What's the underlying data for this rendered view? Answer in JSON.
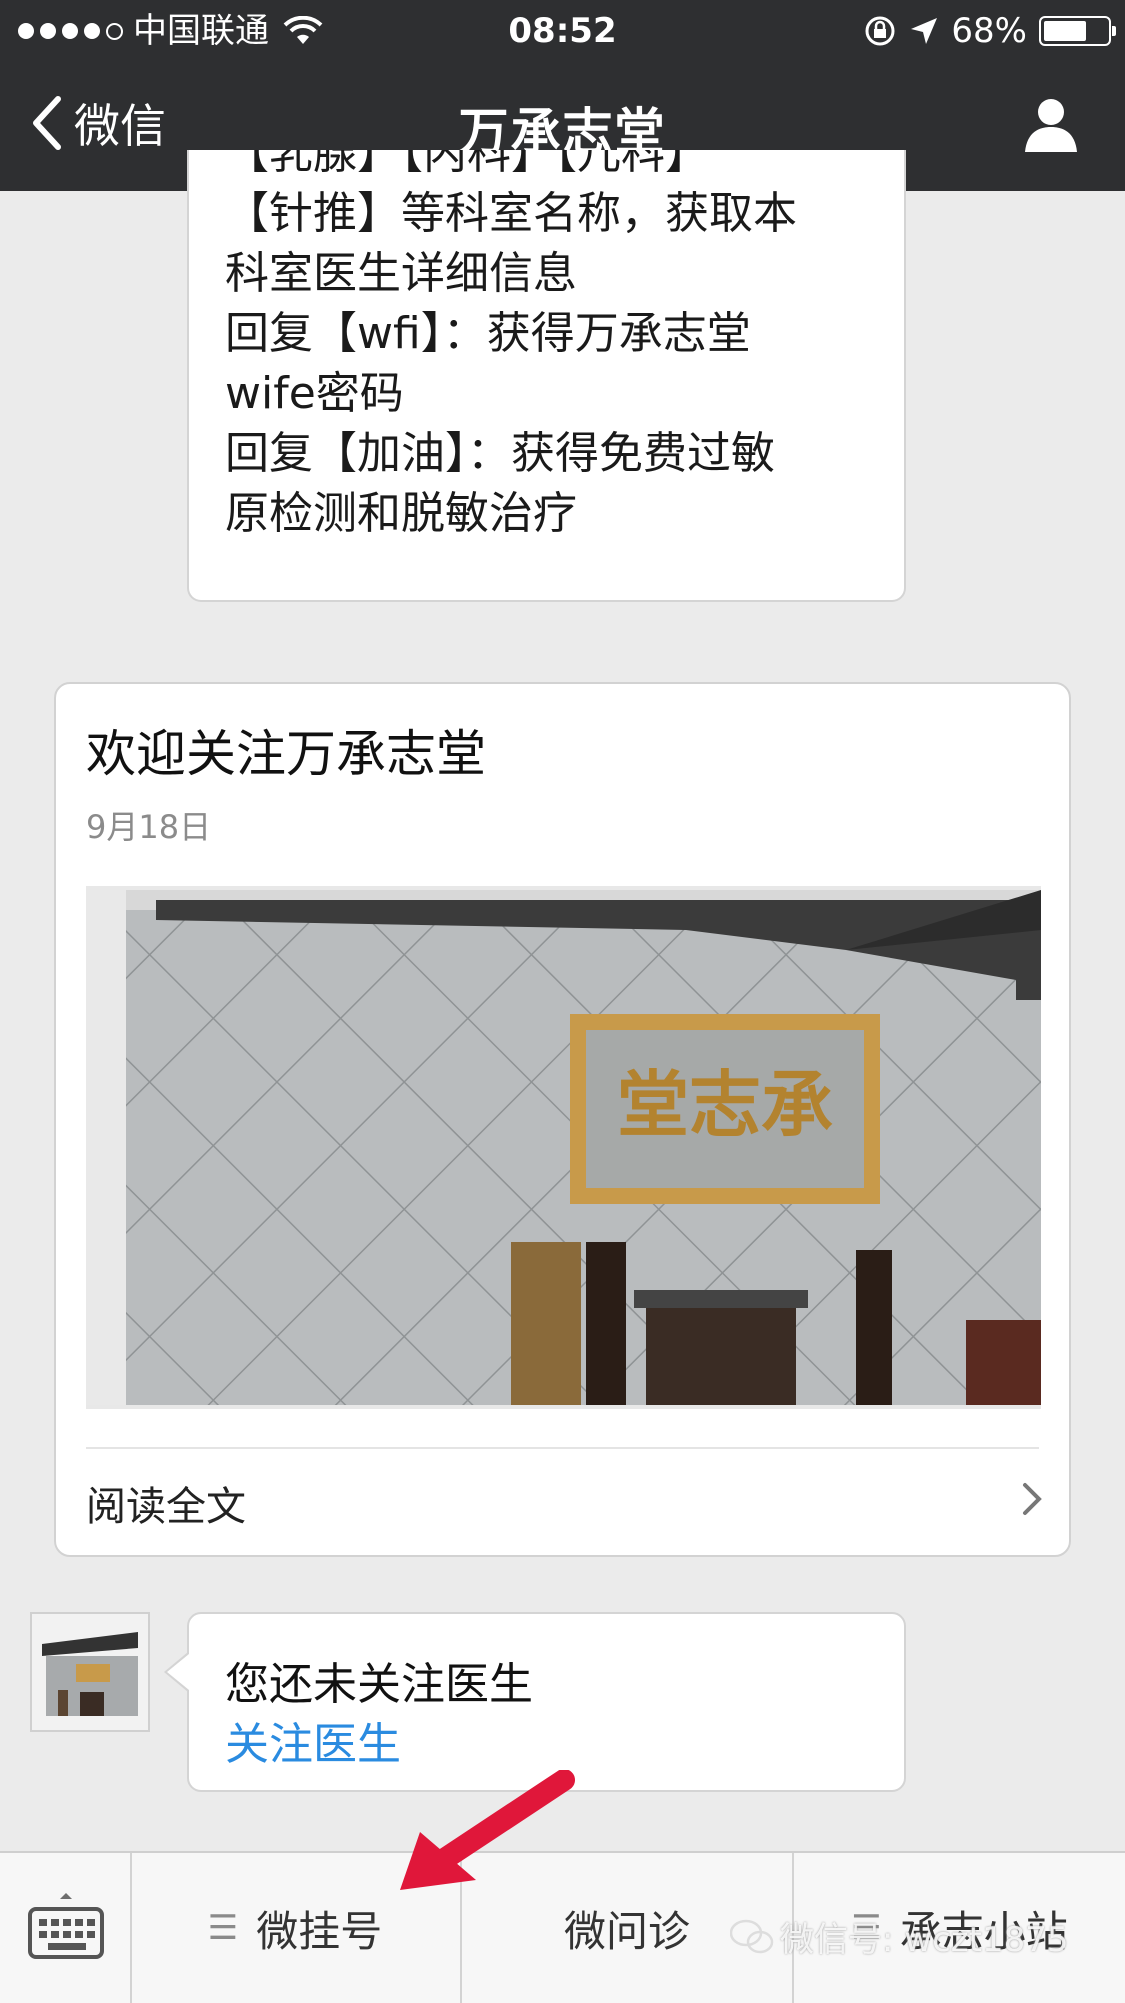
{
  "status_bar": {
    "carrier": "中国联通",
    "time": "08:52",
    "battery": "68%",
    "battery_level": 0.68
  },
  "nav": {
    "back_label": "微信",
    "title": "万承志堂"
  },
  "chat": {
    "first_message_text": "【针推】等科室名称，获取本\n科室医生详细信息\n回复【wfi】：获得万承志堂\nwife密码\n回复【加油】：获得免费过敏\n原检测和脱敏治疗",
    "first_message_top_partial": "【乳腺】【内科】【儿科】",
    "article": {
      "title": "欢迎关注万承志堂",
      "date": "9月18日",
      "plaque_text": "堂志承",
      "read_more": "阅读全文"
    },
    "last_message": {
      "text": "您还未关注医生",
      "link": "关注医生"
    }
  },
  "bottom_menu": {
    "items": [
      {
        "label": "微挂号"
      },
      {
        "label": "微问诊"
      },
      {
        "label": "承志小站"
      }
    ]
  },
  "watermark": "微信号: wczt1875",
  "colors": {
    "nav_bg": "#2e2f31",
    "chat_bg": "#ebebeb",
    "link": "#2a8be0",
    "arrow": "#e0173a"
  }
}
